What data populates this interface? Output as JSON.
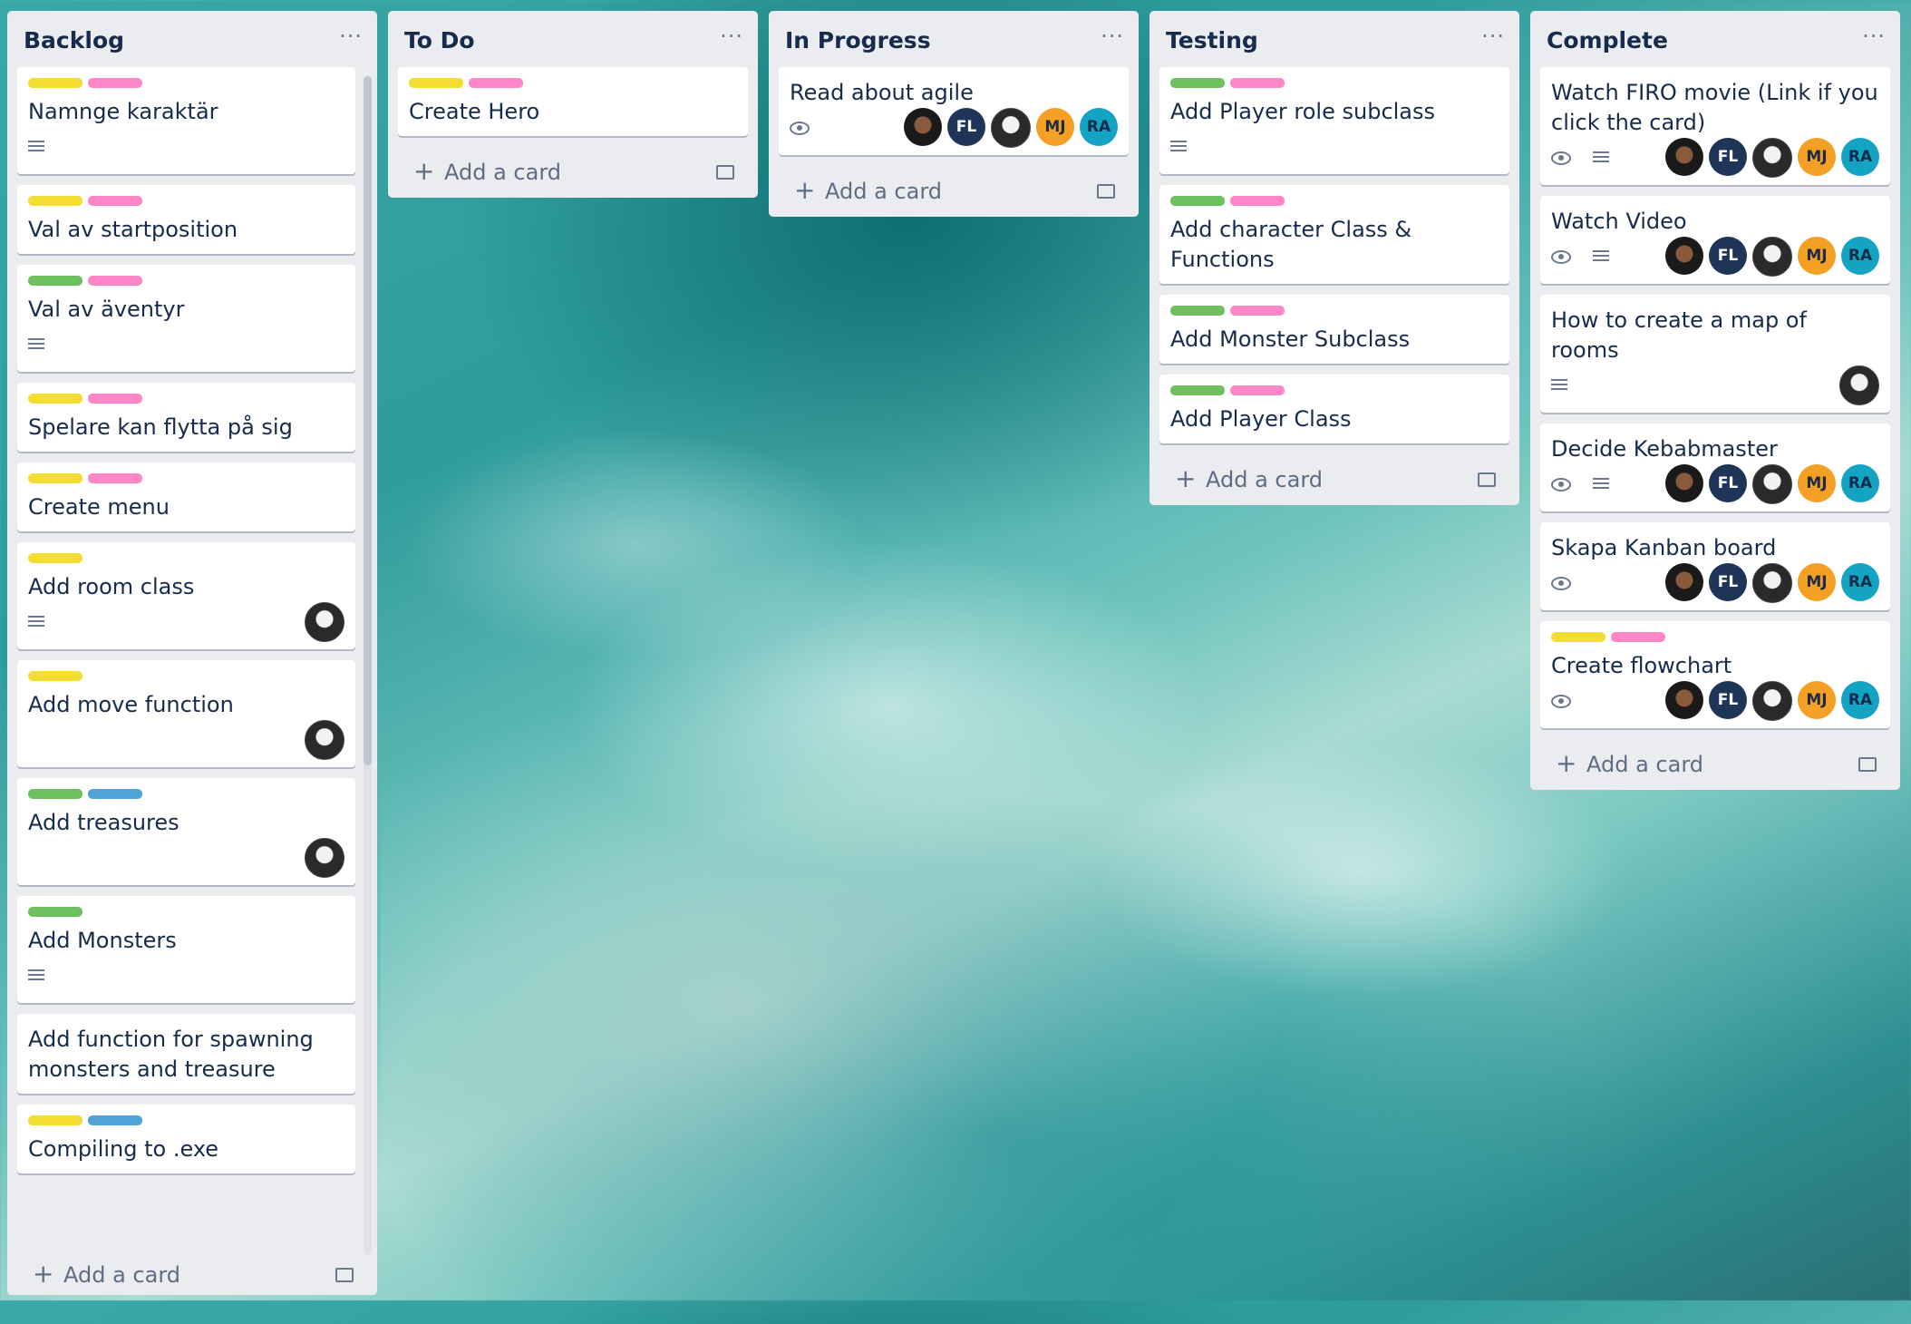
{
  "board": {
    "add_card_label": "Add a card",
    "menu_glyph": "···",
    "lists": [
      {
        "title": "Backlog",
        "cards": [
          {
            "title": "Namnge karaktär",
            "labels": [
              "yellow",
              "pink"
            ],
            "badges": [
              "description"
            ],
            "members": []
          },
          {
            "title": "Val av startposition",
            "labels": [
              "yellow",
              "pink"
            ],
            "badges": [],
            "members": []
          },
          {
            "title": "Val av äventyr",
            "labels": [
              "green",
              "pink"
            ],
            "badges": [
              "description"
            ],
            "members": []
          },
          {
            "title": "Spelare kan flytta på sig",
            "labels": [
              "yellow",
              "pink"
            ],
            "badges": [],
            "members": []
          },
          {
            "title": "Create menu",
            "labels": [
              "yellow",
              "pink"
            ],
            "badges": [],
            "members": []
          },
          {
            "title": "Add room class",
            "labels": [
              "yellow"
            ],
            "badges": [
              "description"
            ],
            "members": [
              "skull"
            ]
          },
          {
            "title": "Add move function",
            "labels": [
              "yellow"
            ],
            "badges": [],
            "members": [
              "skull"
            ]
          },
          {
            "title": "Add treasures",
            "labels": [
              "green",
              "blue"
            ],
            "badges": [],
            "members": [
              "skull"
            ]
          },
          {
            "title": "Add Monsters",
            "labels": [
              "green"
            ],
            "badges": [
              "description"
            ],
            "members": []
          },
          {
            "title": "Add function for spawning monsters and treasure",
            "labels": [],
            "badges": [],
            "members": []
          },
          {
            "title": "Compiling to .exe",
            "labels": [
              "yellow",
              "blue"
            ],
            "badges": [],
            "members": []
          }
        ]
      },
      {
        "title": "To Do",
        "cards": [
          {
            "title": "Create Hero",
            "labels": [
              "yellow",
              "pink"
            ],
            "badges": [],
            "members": []
          }
        ]
      },
      {
        "title": "In Progress",
        "cards": [
          {
            "title": "Read about agile",
            "labels": [],
            "badges": [
              "watch"
            ],
            "members": [
              "photo",
              "FL",
              "skull",
              "MJ",
              "RA"
            ]
          }
        ]
      },
      {
        "title": "Testing",
        "cards": [
          {
            "title": "Add Player role subclass",
            "labels": [
              "green",
              "pink"
            ],
            "badges": [
              "description"
            ],
            "members": []
          },
          {
            "title": "Add character Class & Functions",
            "labels": [
              "green",
              "pink"
            ],
            "badges": [],
            "members": []
          },
          {
            "title": "Add Monster Subclass",
            "labels": [
              "green",
              "pink"
            ],
            "badges": [],
            "members": []
          },
          {
            "title": "Add Player Class",
            "labels": [
              "green",
              "pink"
            ],
            "badges": [],
            "members": []
          }
        ]
      },
      {
        "title": "Complete",
        "cards": [
          {
            "title": "Watch FIRO movie (Link if you click the card)",
            "labels": [],
            "badges": [
              "watch",
              "description"
            ],
            "members": [
              "photo",
              "FL",
              "skull",
              "MJ",
              "RA"
            ]
          },
          {
            "title": "Watch Video",
            "labels": [],
            "badges": [
              "watch",
              "description"
            ],
            "members": [
              "photo",
              "FL",
              "skull",
              "MJ",
              "RA"
            ]
          },
          {
            "title": "How to create a map of rooms",
            "labels": [],
            "badges": [
              "description"
            ],
            "members": [
              "skull"
            ]
          },
          {
            "title": "Decide Kebabmaster",
            "labels": [],
            "badges": [
              "watch",
              "description"
            ],
            "members": [
              "photo",
              "FL",
              "skull",
              "MJ",
              "RA"
            ]
          },
          {
            "title": "Skapa Kanban board",
            "labels": [],
            "badges": [
              "watch"
            ],
            "members": [
              "photo",
              "FL",
              "skull",
              "MJ",
              "RA"
            ]
          },
          {
            "title": "Create flowchart",
            "labels": [
              "yellow",
              "pink"
            ],
            "badges": [
              "watch"
            ],
            "members": [
              "photo",
              "FL",
              "skull",
              "MJ",
              "RA"
            ]
          }
        ]
      }
    ]
  },
  "colors": {
    "list_bg": "#ebecf0",
    "card_bg": "#ffffff",
    "label_yellow": "#f4dd33",
    "label_pink": "#ff87c8",
    "label_green": "#6ebf5e",
    "label_blue": "#4fa3d9"
  }
}
